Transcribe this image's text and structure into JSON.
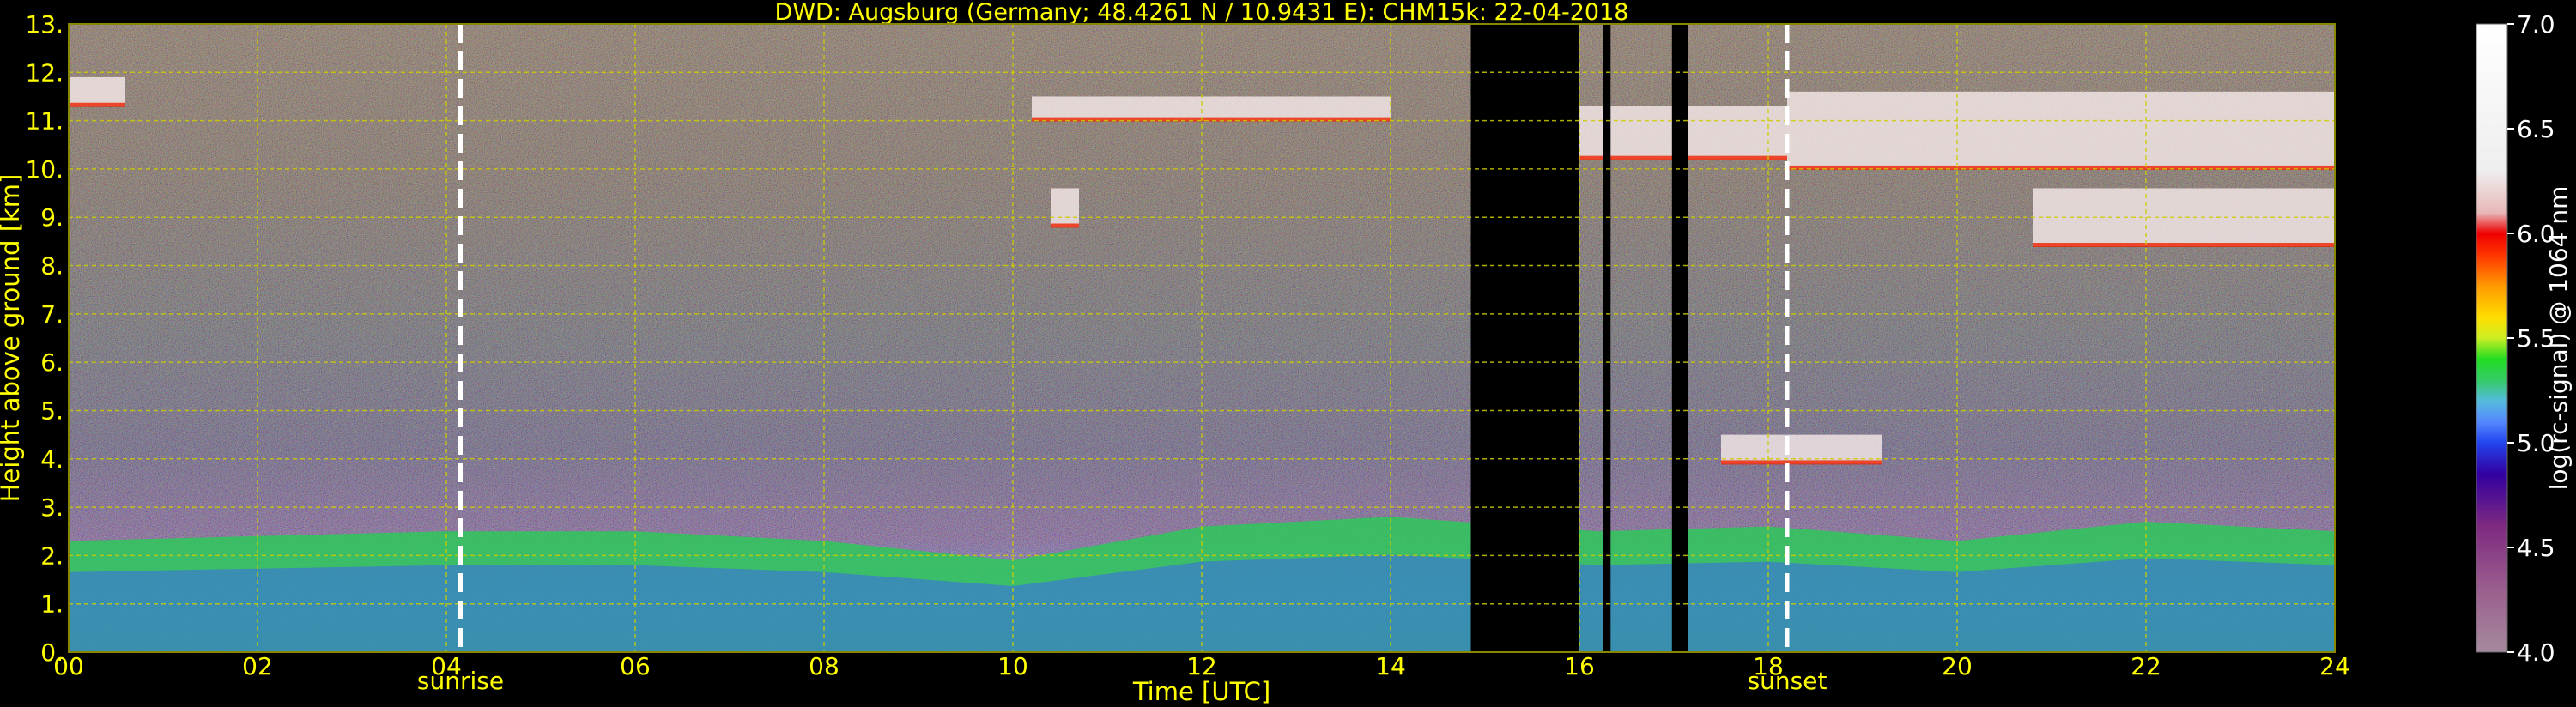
{
  "chart_data": {
    "type": "heatmap",
    "title": "DWD: Augsburg (Germany; 48.4261 N / 10.9431 E):    CHM15k: 22-04-2018",
    "xlabel": "Time [UTC]",
    "ylabel": "Height above ground [km]",
    "xlim": [
      0,
      24
    ],
    "ylim": [
      0,
      13
    ],
    "x_ticks": [
      "00",
      "02",
      "04",
      "06",
      "08",
      "10",
      "12",
      "14",
      "16",
      "18",
      "20",
      "22",
      "24"
    ],
    "y_ticks": [
      "0.",
      "1.",
      "2.",
      "3.",
      "4.",
      "5.",
      "6.",
      "7.",
      "8.",
      "9.",
      "10.",
      "11.",
      "12.",
      "13."
    ],
    "grid": true,
    "events": [
      {
        "label": "sunrise",
        "time": 4.15
      },
      {
        "label": "sunset",
        "time": 18.2
      }
    ],
    "missing_data": [
      {
        "start": 14.85,
        "end": 16.0
      },
      {
        "start": 16.25,
        "end": 16.33
      },
      {
        "start": 16.98,
        "end": 17.15
      }
    ],
    "layers": {
      "boundary_layer_top_km": [
        [
          0,
          2.3
        ],
        [
          2,
          2.4
        ],
        [
          4,
          2.5
        ],
        [
          6,
          2.5
        ],
        [
          8,
          2.3
        ],
        [
          10,
          1.9
        ],
        [
          12,
          2.6
        ],
        [
          14,
          2.8
        ],
        [
          16.2,
          2.5
        ],
        [
          18,
          2.6
        ],
        [
          20,
          2.3
        ],
        [
          22,
          2.7
        ],
        [
          24,
          2.5
        ]
      ],
      "clouds": [
        {
          "start": 0.0,
          "end": 0.6,
          "bottom": 11.3,
          "top": 11.9
        },
        {
          "start": 10.2,
          "end": 14.0,
          "bottom": 11.0,
          "top": 11.5
        },
        {
          "start": 10.4,
          "end": 10.7,
          "bottom": 8.8,
          "top": 9.6
        },
        {
          "start": 16.0,
          "end": 18.2,
          "bottom": 10.2,
          "top": 11.3
        },
        {
          "start": 18.2,
          "end": 24.0,
          "bottom": 10.0,
          "top": 11.6
        },
        {
          "start": 20.8,
          "end": 24.0,
          "bottom": 8.4,
          "top": 9.6
        },
        {
          "start": 17.5,
          "end": 19.2,
          "bottom": 3.9,
          "top": 4.5
        }
      ]
    },
    "colorbar": {
      "label": "log(rc-signal) @ 1064 nm",
      "min": 4.0,
      "max": 7.0,
      "ticks": [
        "4.0",
        "4.5",
        "5.0",
        "5.5",
        "6.0",
        "6.5",
        "7.0"
      ],
      "stops": [
        {
          "v": 4.0,
          "c": "#a58a9c"
        },
        {
          "v": 4.3,
          "c": "#9a5e8e"
        },
        {
          "v": 4.6,
          "c": "#7e2a80"
        },
        {
          "v": 4.85,
          "c": "#3300a0"
        },
        {
          "v": 5.0,
          "c": "#2244ee"
        },
        {
          "v": 5.1,
          "c": "#5588ff"
        },
        {
          "v": 5.2,
          "c": "#55bbdd"
        },
        {
          "v": 5.3,
          "c": "#33cc66"
        },
        {
          "v": 5.4,
          "c": "#22dd22"
        },
        {
          "v": 5.5,
          "c": "#ccee22"
        },
        {
          "v": 5.6,
          "c": "#ffdd00"
        },
        {
          "v": 5.75,
          "c": "#ff9900"
        },
        {
          "v": 5.9,
          "c": "#ff3300"
        },
        {
          "v": 6.0,
          "c": "#ee0000"
        },
        {
          "v": 6.1,
          "c": "#e8b8b8"
        },
        {
          "v": 6.3,
          "c": "#eeeeee"
        },
        {
          "v": 7.0,
          "c": "#ffffff"
        }
      ]
    },
    "colors": {
      "axes_text": "#ffff00",
      "grid": "#cccc00",
      "background": "#000000"
    }
  }
}
